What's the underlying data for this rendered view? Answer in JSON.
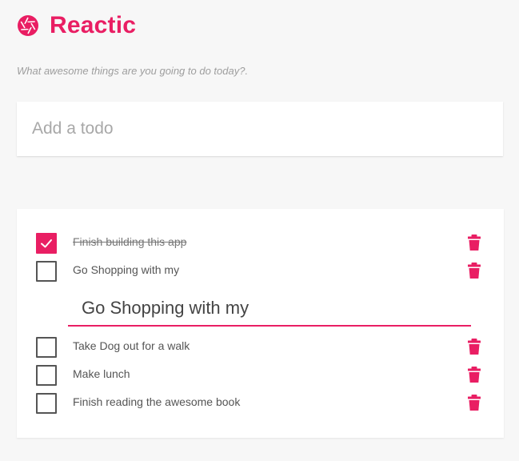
{
  "app": {
    "title": "Reactic",
    "subtitle": "What awesome things are you going to do today?.",
    "logo_icon": "camera-aperture-icon"
  },
  "add_todo": {
    "placeholder": "Add a todo",
    "value": ""
  },
  "todos": [
    {
      "label": "Finish building this app",
      "completed": true,
      "editing": false
    },
    {
      "label": "Go Shopping with my",
      "completed": false,
      "editing": true
    },
    {
      "label": "Take Dog out for a walk",
      "completed": false,
      "editing": false
    },
    {
      "label": "Make lunch",
      "completed": false,
      "editing": false
    },
    {
      "label": "Finish reading the awesome book",
      "completed": false,
      "editing": false
    }
  ],
  "edit_field": {
    "value": "Go Shopping with my"
  },
  "icons": {
    "delete": "trash-icon",
    "check": "checkmark-icon"
  },
  "colors": {
    "accent": "#e91e63",
    "background": "#f7f7f7",
    "card": "#ffffff",
    "text": "#555555",
    "muted": "#9e9e9e"
  }
}
